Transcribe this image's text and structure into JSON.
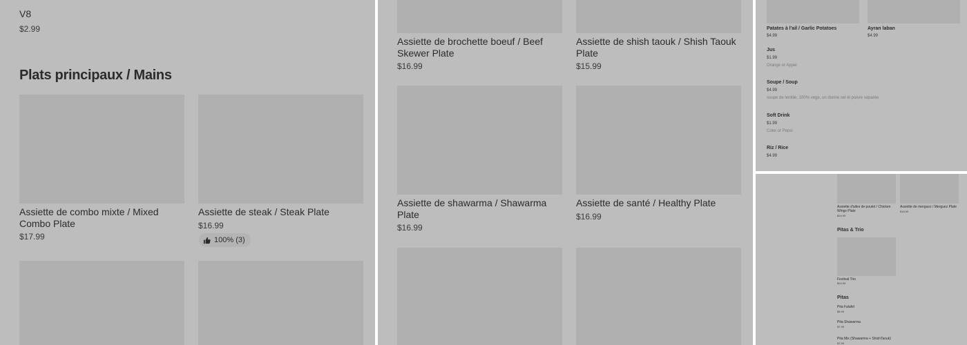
{
  "panel1": {
    "prev_item": {
      "name": "V8",
      "price": "$2.99"
    },
    "section_title": "Plats principaux / Mains",
    "items": [
      {
        "name": "Assiette de combo mixte / Mixed Combo Plate",
        "price": "$17.99"
      },
      {
        "name": "Assiette de  steak / Steak Plate",
        "price": "$16.99",
        "rating": "100% (3)"
      }
    ]
  },
  "panel2": {
    "items": [
      {
        "name": "Assiette de brochette boeuf / Beef Skewer Plate",
        "price": "$16.99"
      },
      {
        "name": "Assiette de shish taouk / Shish Taouk Plate",
        "price": "$15.99"
      },
      {
        "name": "Assiette de shawarma / Shawarma Plate",
        "price": "$16.99"
      },
      {
        "name": "Assiette de santé / Healthy Plate",
        "price": "$16.99"
      }
    ]
  },
  "panel3": {
    "grid_items": [
      {
        "name": "Patates à l'ail / Garlic Potatoes",
        "price": "$4.99"
      },
      {
        "name": "Ayran laban",
        "price": "$4.99"
      }
    ],
    "list_items": [
      {
        "name": "Jus",
        "price": "$1.99",
        "desc": "Orange or Appel"
      },
      {
        "name": "Soupe / Soup",
        "price": "$4.99",
        "desc": "soupe de lentille, 100% vege, on donne sel et poivre séparée"
      },
      {
        "name": "Soft Drink",
        "price": "$1.99",
        "desc": "Coke or Pepsi"
      },
      {
        "name": "Riz / Rice",
        "price": "$4.99",
        "desc": ""
      }
    ]
  },
  "panel4": {
    "grid_items": [
      {
        "name": "Assiette d'ailes de poulet / Chicken Wings Plate",
        "price": "$24.99"
      },
      {
        "name": "Assiette de merguez / Merguez Plate",
        "price": "$18.99"
      }
    ],
    "section_trio": "Pitas & Trio",
    "trio_item": {
      "name": "Festival Trio",
      "price": "$24.99"
    },
    "section_pitas": "Pitas",
    "pitas": [
      {
        "name": "Pita Falafel",
        "price": "$5.99"
      },
      {
        "name": "Pita Shawarma",
        "price": "$7.99"
      },
      {
        "name": "Pita Mix (Shawarma + ShishTaouk)",
        "price": "$7.99"
      }
    ]
  }
}
